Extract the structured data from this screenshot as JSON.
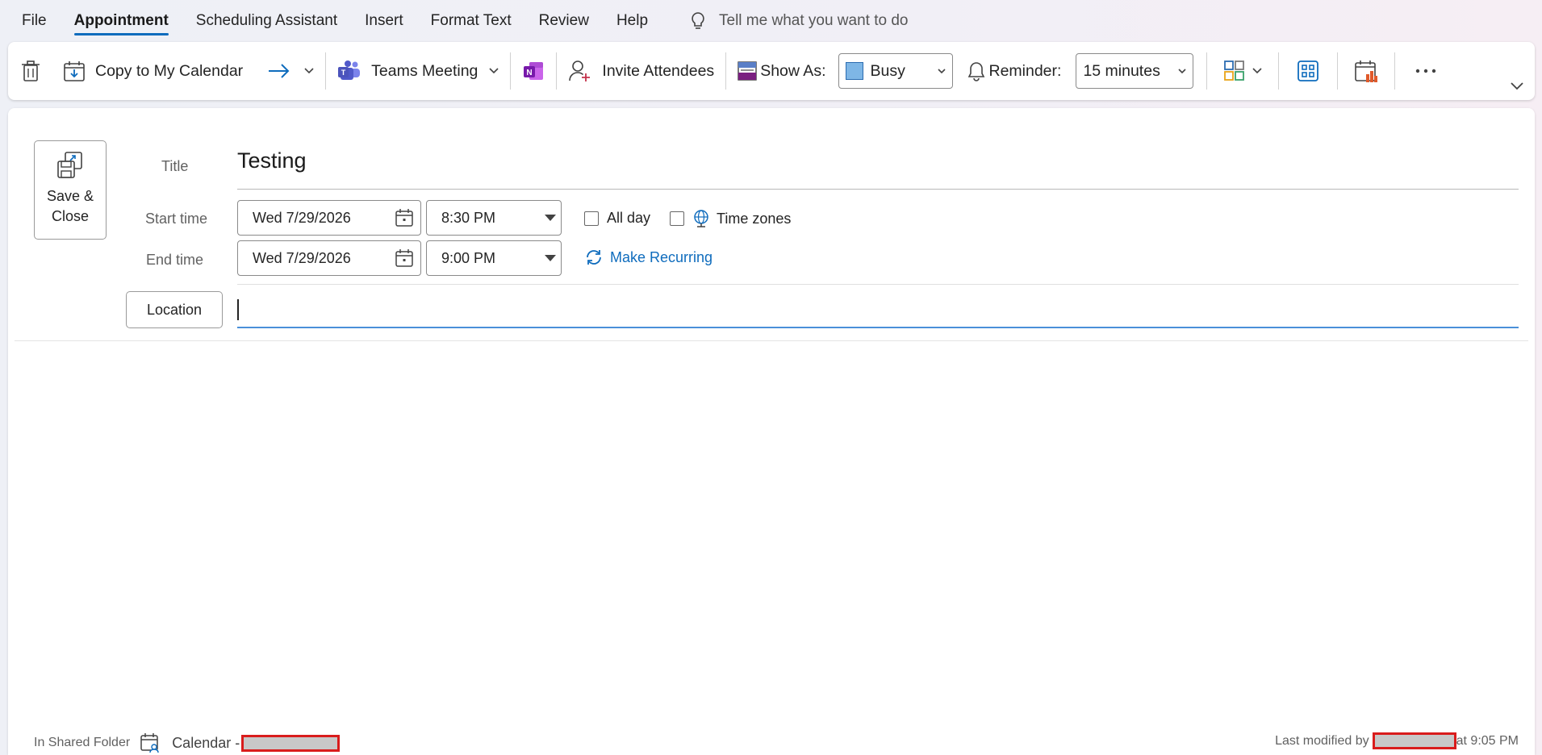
{
  "menu": {
    "items": [
      {
        "label": "File"
      },
      {
        "label": "Appointment"
      },
      {
        "label": "Scheduling Assistant"
      },
      {
        "label": "Insert"
      },
      {
        "label": "Format Text"
      },
      {
        "label": "Review"
      },
      {
        "label": "Help"
      }
    ],
    "active": "Appointment",
    "tell_me": "Tell me what you want to do"
  },
  "ribbon": {
    "copy_to_calendar": "Copy to My Calendar",
    "teams_meeting": "Teams Meeting",
    "invite_attendees": "Invite Attendees",
    "show_as_label": "Show As:",
    "show_as_value": "Busy",
    "reminder_label": "Reminder:",
    "reminder_value": "15 minutes"
  },
  "form": {
    "save_close": "Save &\nClose",
    "title_label": "Title",
    "title_value": "Testing",
    "start_label": "Start time",
    "start_date": "Wed 7/29/2026",
    "start_time": "8:30 PM",
    "end_label": "End time",
    "end_date": "Wed 7/29/2026",
    "end_time": "9:00 PM",
    "all_day": "All day",
    "time_zones": "Time zones",
    "make_recurring": "Make Recurring",
    "location_button": "Location",
    "location_value": ""
  },
  "footer": {
    "in_shared_folder": "In Shared Folder",
    "calendar_label": "Calendar -",
    "last_modified_by": "Last modified by",
    "modified_at": "at 9:05 PM"
  },
  "colors": {
    "accent": "#0f6cbd",
    "busy": "#7eb6e6",
    "redaction_border": "#d91c1c"
  }
}
